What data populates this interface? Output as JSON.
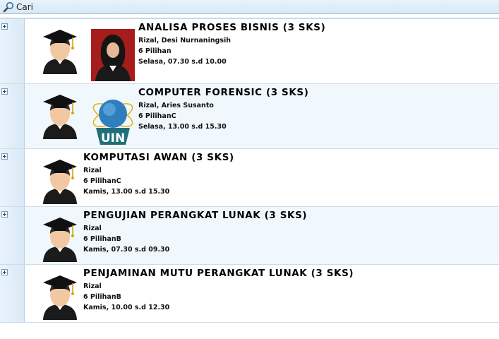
{
  "toolbar": {
    "search_label": "Cari",
    "search_icon": "magnifier-icon"
  },
  "icons": {
    "expand": "plus-box-icon",
    "avatar": "graduate-avatar-icon",
    "logo": "uin-logo"
  },
  "colors": {
    "row_alt_background": "#f1f8fd",
    "gutter": "#dcebf7",
    "toolbar": "#dbeaf7"
  },
  "courses": [
    {
      "title": "ANALISA PROSES BISNIS (3 SKS)",
      "lecturer": "Rizal, Desi Nurnaningsih",
      "class": "6 Pilihan",
      "schedule": "Selasa, 07.30 s.d 10.00",
      "image": "lecturer-photo"
    },
    {
      "title": "COMPUTER FORENSIC (3 SKS)",
      "lecturer": "Rizal, Aries Susanto",
      "class": "6 PilihanC",
      "schedule": "Selasa, 13.00 s.d 15.30",
      "image": "uin-logo"
    },
    {
      "title": "KOMPUTASI AWAN (3 SKS)",
      "lecturer": "Rizal",
      "class": "6 PilihanC",
      "schedule": "Kamis, 13.00 s.d 15.30",
      "image": ""
    },
    {
      "title": "PENGUJIAN PERANGKAT LUNAK (3 SKS)",
      "lecturer": "Rizal",
      "class": "6 PilihanB",
      "schedule": "Kamis, 07.30 s.d 09.30",
      "image": ""
    },
    {
      "title": "PENJAMINAN MUTU PERANGKAT LUNAK (3 SKS)",
      "lecturer": "Rizal",
      "class": "6 PilihanB",
      "schedule": "Kamis, 10.00 s.d 12.30",
      "image": ""
    }
  ]
}
